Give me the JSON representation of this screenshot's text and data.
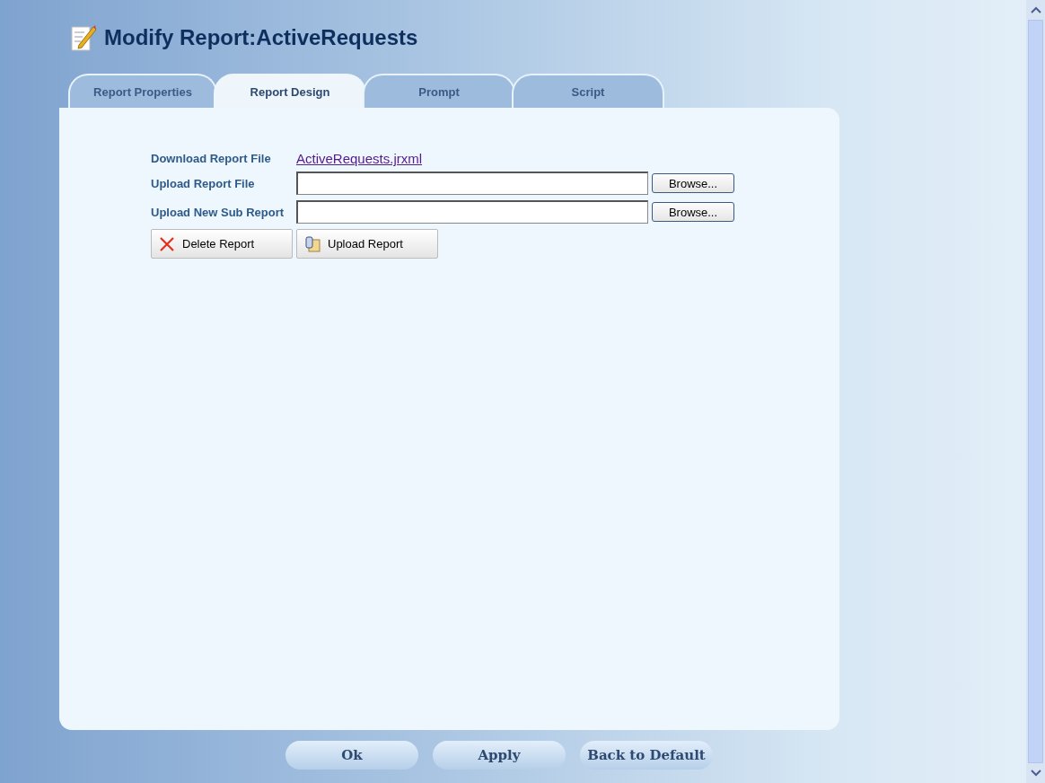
{
  "title": "Modify Report:ActiveRequests",
  "tabs": [
    {
      "label": "Report Properties",
      "selected": false
    },
    {
      "label": "Report Design",
      "selected": true
    },
    {
      "label": "Prompt",
      "selected": false
    },
    {
      "label": "Script",
      "selected": false
    }
  ],
  "download": {
    "label": "Download Report File",
    "link": "ActiveRequests.jrxml"
  },
  "uploads": [
    {
      "label": "Upload Report File",
      "button": "Browse..."
    },
    {
      "label": "Upload New Sub Report",
      "button": "Browse..."
    }
  ],
  "actions": [
    {
      "kind": "delete",
      "label": "Delete Report"
    },
    {
      "kind": "upload",
      "label": "Upload Report"
    }
  ],
  "footer_buttons": [
    "Ok",
    "Apply",
    "Back to Default"
  ]
}
